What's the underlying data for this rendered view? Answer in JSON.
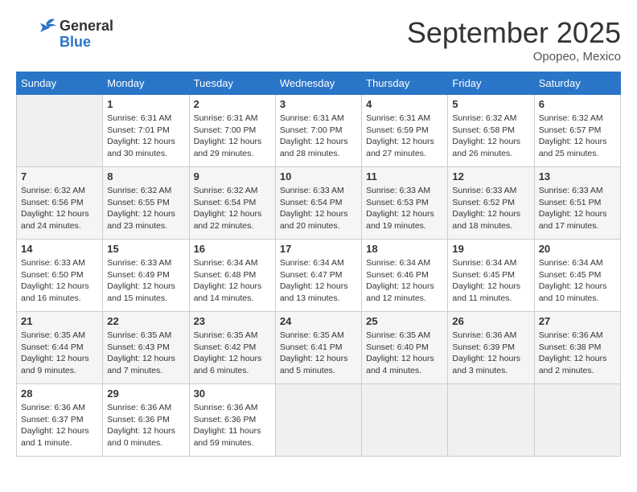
{
  "logo": {
    "general": "General",
    "blue": "Blue"
  },
  "title": {
    "month": "September 2025",
    "location": "Opopeo, Mexico"
  },
  "weekdays": [
    "Sunday",
    "Monday",
    "Tuesday",
    "Wednesday",
    "Thursday",
    "Friday",
    "Saturday"
  ],
  "weeks": [
    [
      {
        "day": "",
        "info": ""
      },
      {
        "day": "1",
        "info": "Sunrise: 6:31 AM\nSunset: 7:01 PM\nDaylight: 12 hours\nand 30 minutes."
      },
      {
        "day": "2",
        "info": "Sunrise: 6:31 AM\nSunset: 7:00 PM\nDaylight: 12 hours\nand 29 minutes."
      },
      {
        "day": "3",
        "info": "Sunrise: 6:31 AM\nSunset: 7:00 PM\nDaylight: 12 hours\nand 28 minutes."
      },
      {
        "day": "4",
        "info": "Sunrise: 6:31 AM\nSunset: 6:59 PM\nDaylight: 12 hours\nand 27 minutes."
      },
      {
        "day": "5",
        "info": "Sunrise: 6:32 AM\nSunset: 6:58 PM\nDaylight: 12 hours\nand 26 minutes."
      },
      {
        "day": "6",
        "info": "Sunrise: 6:32 AM\nSunset: 6:57 PM\nDaylight: 12 hours\nand 25 minutes."
      }
    ],
    [
      {
        "day": "7",
        "info": "Sunrise: 6:32 AM\nSunset: 6:56 PM\nDaylight: 12 hours\nand 24 minutes."
      },
      {
        "day": "8",
        "info": "Sunrise: 6:32 AM\nSunset: 6:55 PM\nDaylight: 12 hours\nand 23 minutes."
      },
      {
        "day": "9",
        "info": "Sunrise: 6:32 AM\nSunset: 6:54 PM\nDaylight: 12 hours\nand 22 minutes."
      },
      {
        "day": "10",
        "info": "Sunrise: 6:33 AM\nSunset: 6:54 PM\nDaylight: 12 hours\nand 20 minutes."
      },
      {
        "day": "11",
        "info": "Sunrise: 6:33 AM\nSunset: 6:53 PM\nDaylight: 12 hours\nand 19 minutes."
      },
      {
        "day": "12",
        "info": "Sunrise: 6:33 AM\nSunset: 6:52 PM\nDaylight: 12 hours\nand 18 minutes."
      },
      {
        "day": "13",
        "info": "Sunrise: 6:33 AM\nSunset: 6:51 PM\nDaylight: 12 hours\nand 17 minutes."
      }
    ],
    [
      {
        "day": "14",
        "info": "Sunrise: 6:33 AM\nSunset: 6:50 PM\nDaylight: 12 hours\nand 16 minutes."
      },
      {
        "day": "15",
        "info": "Sunrise: 6:33 AM\nSunset: 6:49 PM\nDaylight: 12 hours\nand 15 minutes."
      },
      {
        "day": "16",
        "info": "Sunrise: 6:34 AM\nSunset: 6:48 PM\nDaylight: 12 hours\nand 14 minutes."
      },
      {
        "day": "17",
        "info": "Sunrise: 6:34 AM\nSunset: 6:47 PM\nDaylight: 12 hours\nand 13 minutes."
      },
      {
        "day": "18",
        "info": "Sunrise: 6:34 AM\nSunset: 6:46 PM\nDaylight: 12 hours\nand 12 minutes."
      },
      {
        "day": "19",
        "info": "Sunrise: 6:34 AM\nSunset: 6:45 PM\nDaylight: 12 hours\nand 11 minutes."
      },
      {
        "day": "20",
        "info": "Sunrise: 6:34 AM\nSunset: 6:45 PM\nDaylight: 12 hours\nand 10 minutes."
      }
    ],
    [
      {
        "day": "21",
        "info": "Sunrise: 6:35 AM\nSunset: 6:44 PM\nDaylight: 12 hours\nand 9 minutes."
      },
      {
        "day": "22",
        "info": "Sunrise: 6:35 AM\nSunset: 6:43 PM\nDaylight: 12 hours\nand 7 minutes."
      },
      {
        "day": "23",
        "info": "Sunrise: 6:35 AM\nSunset: 6:42 PM\nDaylight: 12 hours\nand 6 minutes."
      },
      {
        "day": "24",
        "info": "Sunrise: 6:35 AM\nSunset: 6:41 PM\nDaylight: 12 hours\nand 5 minutes."
      },
      {
        "day": "25",
        "info": "Sunrise: 6:35 AM\nSunset: 6:40 PM\nDaylight: 12 hours\nand 4 minutes."
      },
      {
        "day": "26",
        "info": "Sunrise: 6:36 AM\nSunset: 6:39 PM\nDaylight: 12 hours\nand 3 minutes."
      },
      {
        "day": "27",
        "info": "Sunrise: 6:36 AM\nSunset: 6:38 PM\nDaylight: 12 hours\nand 2 minutes."
      }
    ],
    [
      {
        "day": "28",
        "info": "Sunrise: 6:36 AM\nSunset: 6:37 PM\nDaylight: 12 hours\nand 1 minute."
      },
      {
        "day": "29",
        "info": "Sunrise: 6:36 AM\nSunset: 6:36 PM\nDaylight: 12 hours\nand 0 minutes."
      },
      {
        "day": "30",
        "info": "Sunrise: 6:36 AM\nSunset: 6:36 PM\nDaylight: 11 hours\nand 59 minutes."
      },
      {
        "day": "",
        "info": ""
      },
      {
        "day": "",
        "info": ""
      },
      {
        "day": "",
        "info": ""
      },
      {
        "day": "",
        "info": ""
      }
    ]
  ]
}
